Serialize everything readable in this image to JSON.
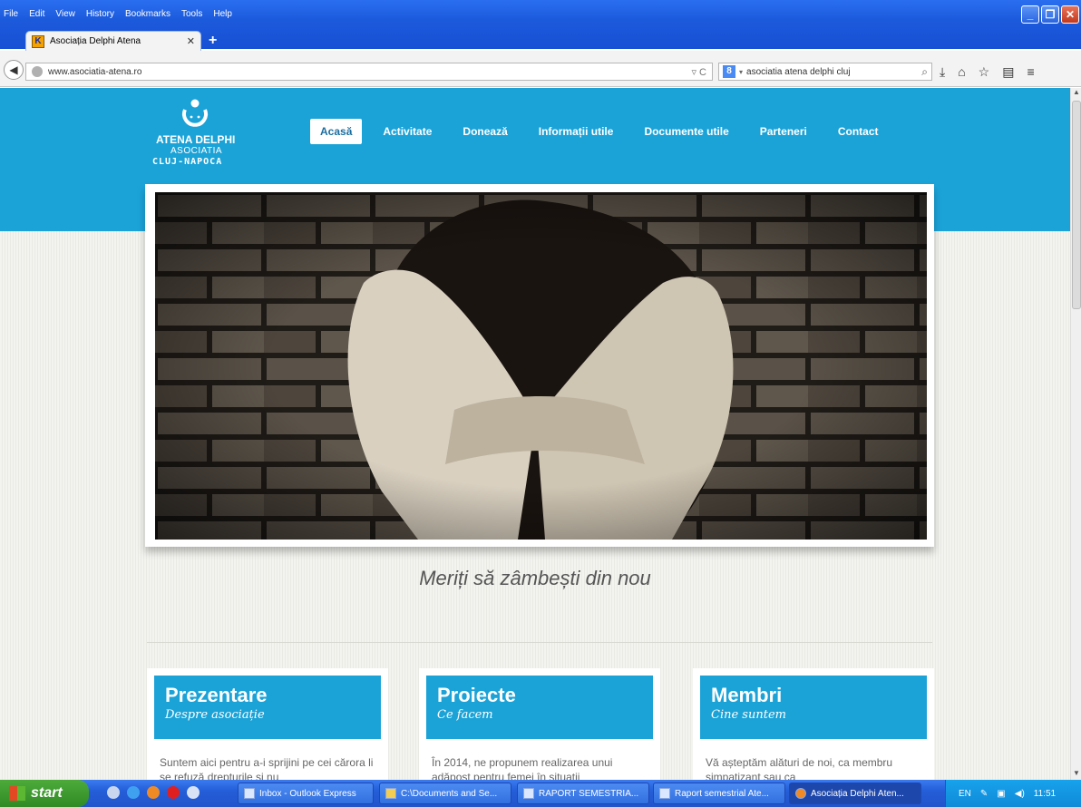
{
  "browser": {
    "menu": [
      "File",
      "Edit",
      "View",
      "History",
      "Bookmarks",
      "Tools",
      "Help"
    ],
    "tab": {
      "title": "Asociația Delphi Atena",
      "favicon": "K"
    },
    "url": "www.asociatia-atena.ro",
    "search_text": "asociatia atena delphi cluj",
    "window_buttons": [
      "minimize",
      "restore",
      "close"
    ]
  },
  "site": {
    "logo": {
      "name": "ATENA DELPHI",
      "sub": "ASOCIATIA",
      "city": "CLUJ-NAPOCA"
    },
    "nav": [
      {
        "label": "Acasă",
        "active": true
      },
      {
        "label": "Activitate"
      },
      {
        "label": "Donează"
      },
      {
        "label": "Informații utile"
      },
      {
        "label": "Documente utile"
      },
      {
        "label": "Parteneri"
      },
      {
        "label": "Contact"
      }
    ],
    "tagline": "Meriți să zâmbești din nou",
    "cards": [
      {
        "title": "Prezentare",
        "subtitle": "Despre asociație",
        "body": "Suntem aici pentru a-i sprijini pe cei cărora li se refuză drepturile și nu"
      },
      {
        "title": "Proiecte",
        "subtitle": "Ce facem",
        "body": "În 2014, ne propunem realizarea unui adăpost pentru femei în situații"
      },
      {
        "title": "Membri",
        "subtitle": "Cine suntem",
        "body": "Vă așteptăm alături de noi, ca membru simpatizant sau ca"
      }
    ],
    "colors": {
      "brand": "#1ba3d8",
      "tagline": "#555555"
    }
  },
  "taskbar": {
    "start": "start",
    "buttons": [
      {
        "label": "Inbox - Outlook Express"
      },
      {
        "label": "C:\\Documents and Se..."
      },
      {
        "label": "RAPORT SEMESTRIA..."
      },
      {
        "label": "Raport semestrial Ate..."
      },
      {
        "label": "Asociația Delphi Aten...",
        "active": true
      }
    ],
    "tray": {
      "lang": "EN",
      "time": "11:51"
    }
  }
}
